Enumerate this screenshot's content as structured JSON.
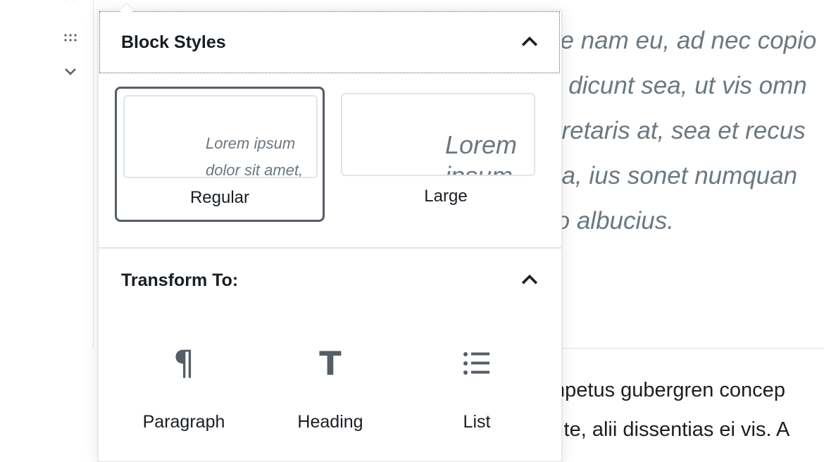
{
  "editor": {
    "paragraph_italic_lines": [
      "se nam eu, ad nec copio",
      "e dicunt sea, ut vis omn",
      "oretaris at, sea et recus",
      " ea, ius sonet numquan",
      "ro albucius."
    ],
    "paragraph_normal_lines": [
      "mpetus gubergren concep",
      "s te, alii dissentias ei vis. A"
    ]
  },
  "popover": {
    "block_styles_title": "Block Styles",
    "styles": [
      {
        "label": "Regular",
        "preview": "Lorem ipsum dolor sit amet,",
        "selected": true
      },
      {
        "label": "Large",
        "preview": "Lorem ipsum",
        "selected": false
      }
    ],
    "transform_title": "Transform To:",
    "transforms": [
      {
        "label": "Paragraph",
        "icon": "paragraph-icon"
      },
      {
        "label": "Heading",
        "icon": "heading-icon"
      },
      {
        "label": "List",
        "icon": "list-icon"
      }
    ]
  },
  "colors": {
    "text_dark": "#191e23",
    "icon_gray": "#555d66",
    "muted_text": "#6c7781",
    "border_light": "#e2e4e7"
  }
}
